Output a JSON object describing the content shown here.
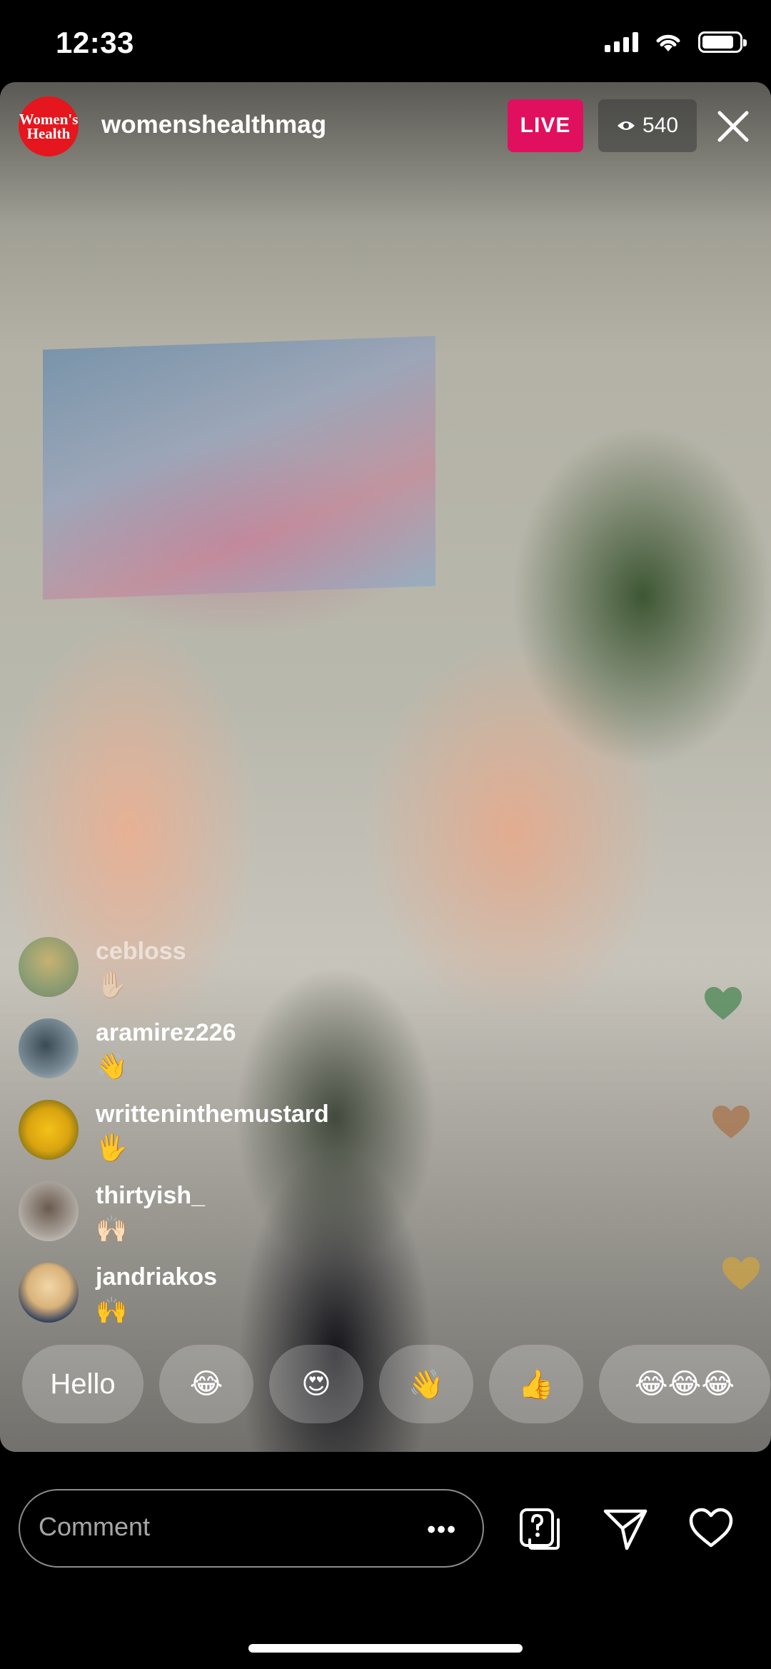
{
  "status_bar": {
    "time": "12:33",
    "battery_level": 0.85
  },
  "header": {
    "avatar_logo_text": "Women's Health",
    "username": "womenshealthmag",
    "live_label": "LIVE",
    "viewer_count": "540",
    "live_color": "#e0105f"
  },
  "comments": [
    {
      "username": "cebloss",
      "text": "✋🏻"
    },
    {
      "username": "aramirez226",
      "text": "👋"
    },
    {
      "username": "writteninthemustard",
      "text": "🖐"
    },
    {
      "username": "thirtyish_",
      "text": "🙌🏻"
    },
    {
      "username": "jandriakos",
      "text": "🙌"
    }
  ],
  "floating_hearts": [
    {
      "color": "#2f7a3d"
    },
    {
      "color": "#a8744a"
    },
    {
      "color": "#c8a24a"
    }
  ],
  "quick_replies": [
    "Hello",
    "😂",
    "😍",
    "👋",
    "👍",
    "😂😂😂"
  ],
  "comment_input": {
    "placeholder": "Comment",
    "more_label": "•••"
  }
}
